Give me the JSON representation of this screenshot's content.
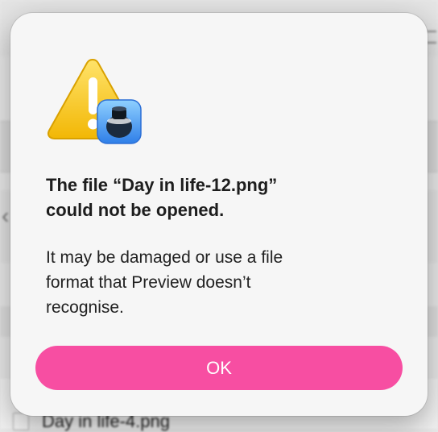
{
  "background": {
    "file_label": "Day in life-4.png"
  },
  "alert": {
    "title": "The file “Day in life-12.png”\ncould not be opened.",
    "message": "It may be damaged or use a file\nformat that Preview doesn’t\nrecognise.",
    "ok_label": "OK",
    "icons": [
      "warning-icon",
      "preview-app-icon"
    ],
    "accent_color": "#f74ea2"
  }
}
